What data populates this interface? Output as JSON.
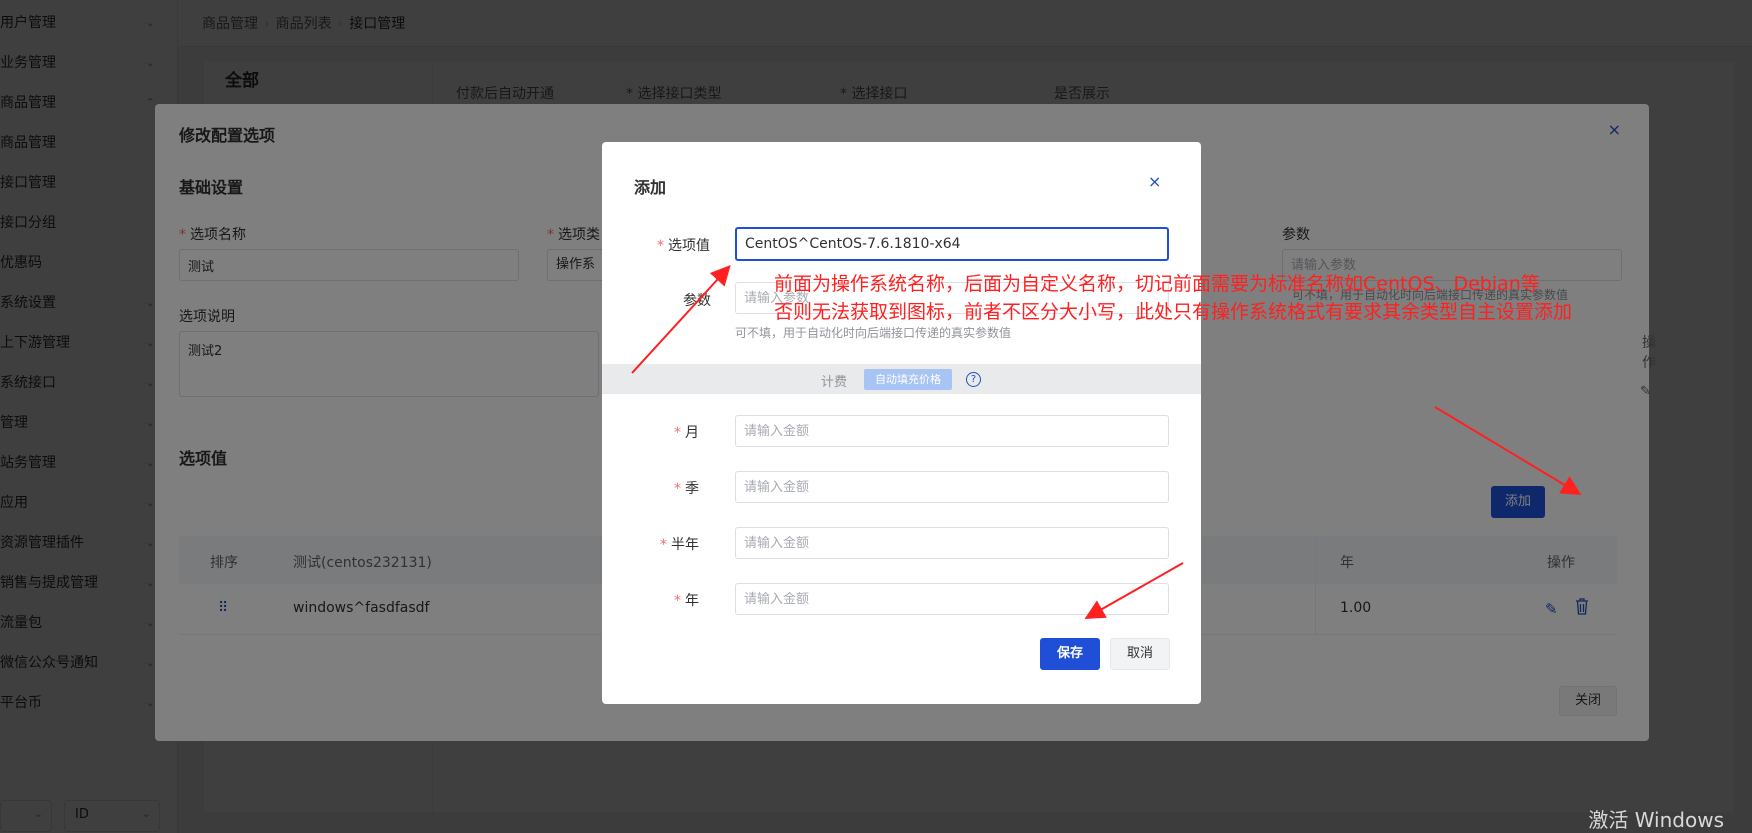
{
  "sidebar": {
    "items": [
      {
        "label": "用户管理",
        "chevron": "⌄"
      },
      {
        "label": "业务管理",
        "chevron": "⌄"
      },
      {
        "label": "商品管理",
        "chevron": "⌃"
      },
      {
        "label": "商品管理",
        "chevron": ""
      },
      {
        "label": "接口管理",
        "chevron": ""
      },
      {
        "label": "接口分组",
        "chevron": ""
      },
      {
        "label": "优惠码",
        "chevron": ""
      },
      {
        "label": "系统设置",
        "chevron": "⌄"
      },
      {
        "label": "上下游管理",
        "chevron": "⌄"
      },
      {
        "label": "系统接口",
        "chevron": "⌄"
      },
      {
        "label": "管理",
        "chevron": "⌄"
      },
      {
        "label": "站务管理",
        "chevron": "⌄"
      },
      {
        "label": "应用",
        "chevron": "⌄"
      },
      {
        "label": "资源管理插件",
        "chevron": "⌄"
      },
      {
        "label": "销售与提成管理",
        "chevron": "⌄"
      },
      {
        "label": "流量包",
        "chevron": "⌄"
      },
      {
        "label": "微信公众号通知",
        "chevron": "⌄"
      },
      {
        "label": "平台币",
        "chevron": "⌄"
      }
    ],
    "bottom_select_1": "",
    "bottom_select_2": "ID"
  },
  "breadcrumb": {
    "items": [
      "商品管理",
      "商品列表",
      "接口管理"
    ]
  },
  "page": {
    "all_label": "全部",
    "columns": [
      "付款后自动开通",
      "* 选择接口类型",
      "* 选择接口",
      "是否展示"
    ]
  },
  "config_dialog": {
    "title": "修改配置选项",
    "close": "×",
    "basic_section": "基础设置",
    "option_name_label": "选项名称",
    "option_name_value": "测试",
    "option_type_label": "选项类",
    "option_type_value": "操作系",
    "param_label": "参数",
    "param_placeholder": "请输入参数",
    "param_hint": "可不填，用于自动化时向后端接口传递的真实参数值",
    "desc_label": "选项说明",
    "desc_value": "测试2",
    "values_section": "选项值",
    "add_button": "添加",
    "close_button": "关闭",
    "table": {
      "headers": [
        "排序",
        "测试(centos232131)",
        "年",
        "操作"
      ],
      "rows": [
        {
          "name": "windows^fasdfasdf",
          "year": "1.00"
        }
      ]
    },
    "right_ops_label": "操作"
  },
  "add_dialog": {
    "title": "添加",
    "close": "×",
    "value_label": "选项值",
    "value_input": "CentOS^CentOS-7.6.1810-x64",
    "param_label": "参数",
    "param_placeholder": "请输入参数",
    "param_hint": "可不填，用于自动化时向后端接口传递的真实参数值",
    "billing_label": "计费",
    "autofill_button": "自动填充价格",
    "help_icon": "?",
    "prices": [
      {
        "label": "月",
        "placeholder": "请输入金额"
      },
      {
        "label": "季",
        "placeholder": "请输入金额"
      },
      {
        "label": "半年",
        "placeholder": "请输入金额"
      },
      {
        "label": "年",
        "placeholder": "请输入金额"
      }
    ],
    "save_button": "保存",
    "cancel_button": "取消"
  },
  "annotation": {
    "line1": "前面为操作系统名称，后面为自定义名称，切记前面需要为标准名称如CentOS、Debian等",
    "line2": "否则无法获取到图标，前者不区分大小写，此处只有操作系统格式有要求其余类型自主设置添加",
    "color": "#ff2020"
  },
  "watermark": "激活 Windows",
  "colors": {
    "primary": "#1f4fd6",
    "required": "#f56c6c",
    "annotation": "#ff2020"
  }
}
